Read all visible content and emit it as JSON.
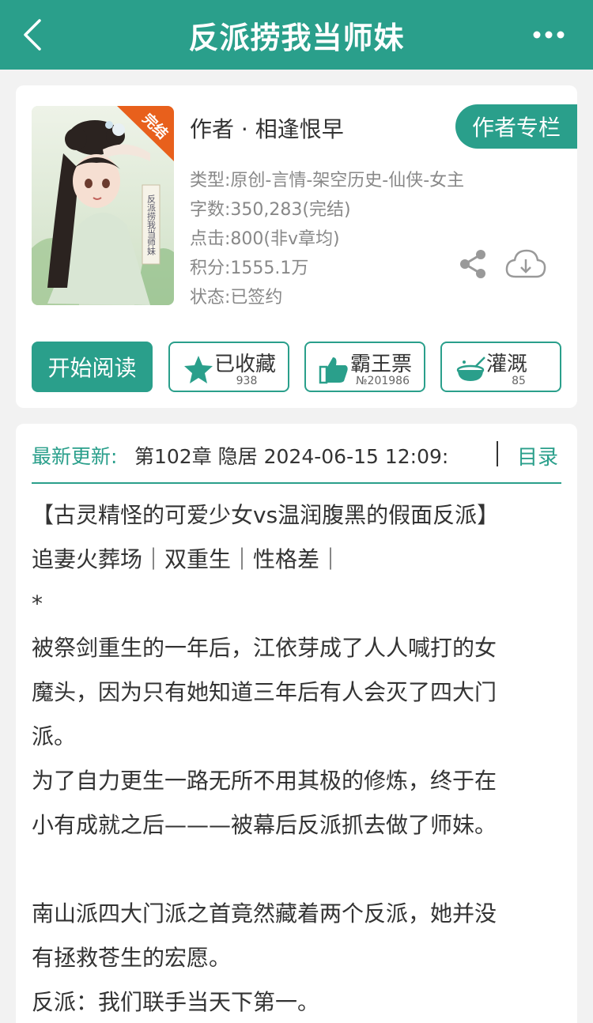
{
  "header": {
    "title": "反派捞我当师妹",
    "back_icon": "chevron-left-icon",
    "more_icon": "more-dots-icon"
  },
  "book": {
    "cover_badge": "完结",
    "cover_title": "反派捞我当师妹",
    "author_line": "作者 · 相逢恨早",
    "author_column_label": "作者专栏",
    "type": "类型:原创-言情-架空历史-仙侠-女主",
    "word_count": "字数:350,283(完结)",
    "clicks": "点击:800(非v章均)",
    "points": "积分:1555.1万",
    "status": "状态:已签约"
  },
  "actions": {
    "read_label": "开始阅读",
    "collect_label": "已收藏",
    "collect_count": "938",
    "ticket_label": "霸王票",
    "ticket_count": "№201986",
    "water_label": "灌溉",
    "water_count": "85"
  },
  "update": {
    "label": "最新更新:",
    "text": "第102章 隐居 2024-06-15 12:09:",
    "toc_label": "目录"
  },
  "description": {
    "line1": "【古灵精怪的可爱少女vs温润腹黑的假面反派】",
    "line2": "追妻火葬场｜双重生｜性格差｜",
    "line3": "*",
    "line4": "被祭剑重生的一年后，江依芽成了人人喊打的女",
    "line5": "魔头，因为只有她知道三年后有人会灭了四大门",
    "line6": "派。",
    "line7": "为了自力更生一路无所不用其极的修炼，终于在",
    "line8": "小有成就之后———被幕后反派抓去做了师妹。",
    "line9": "南山派四大门派之首竟然藏着两个反派，她并没",
    "line10": "有拯救苍生的宏愿。",
    "line11": "反派：我们联手当天下第一。"
  },
  "colors": {
    "accent": "#2a9f8b",
    "background": "#f2f2f2",
    "muted_text": "#888888"
  }
}
